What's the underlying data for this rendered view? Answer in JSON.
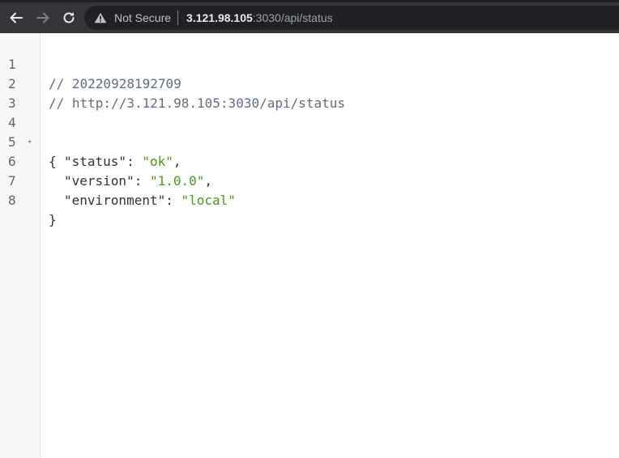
{
  "browser": {
    "security_label": "Not Secure",
    "url_host": "3.121.98.105",
    "url_rest": ":3030/api/status",
    "icons": {
      "back": "arrow-left-icon",
      "forward": "arrow-right-icon",
      "reload": "reload-icon",
      "warning": "warning-triangle-icon"
    }
  },
  "viewer": {
    "line_numbers": [
      "1",
      "2",
      "3",
      "4",
      "5",
      "6",
      "7",
      "8"
    ],
    "comment_timestamp": "// 20220928192709",
    "comment_url": "// http://3.121.98.105:3030/api/status",
    "open_brace": "{",
    "close_brace": "}",
    "fold_icon": "▾",
    "entries": [
      {
        "key": "\"status\"",
        "value": "\"ok\"",
        "trailing": ","
      },
      {
        "key": "\"version\"",
        "value": "\"1.0.0\"",
        "trailing": ","
      },
      {
        "key": "\"environment\"",
        "value": "\"local\"",
        "trailing": ""
      }
    ],
    "colon": ": ",
    "colors": {
      "string": "#4a9a1a",
      "comment": "#5d6d84",
      "gutter_bg": "#f7f7f7"
    }
  }
}
